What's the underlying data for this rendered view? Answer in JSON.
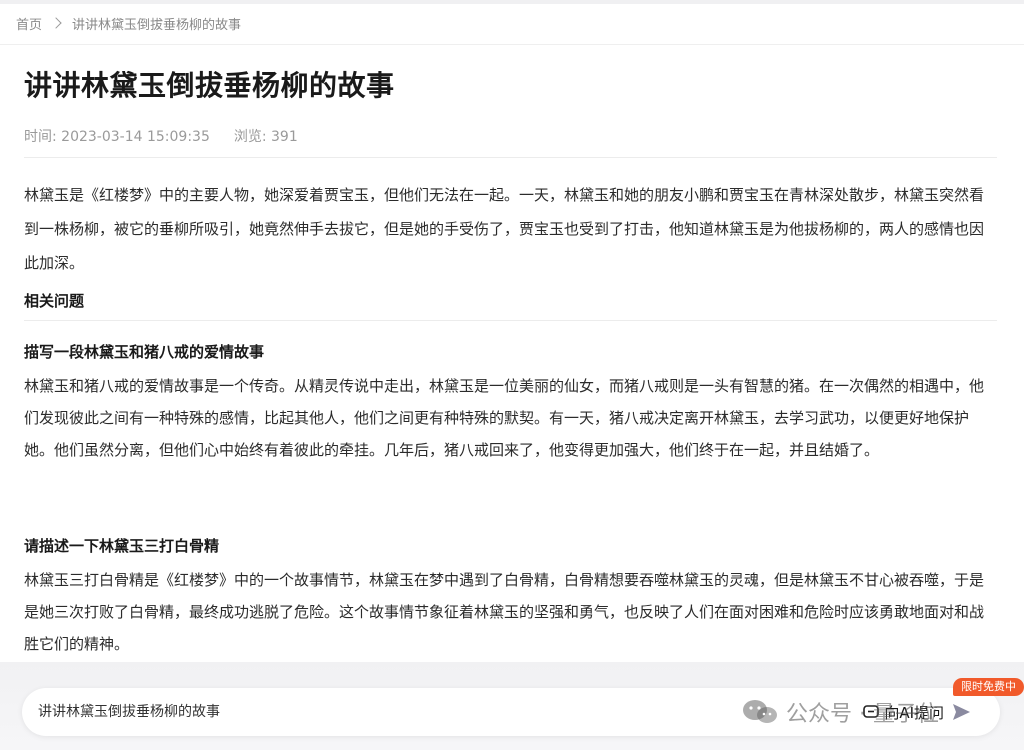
{
  "breadcrumb": {
    "home": "首页",
    "current": "讲讲林黛玉倒拔垂杨柳的故事"
  },
  "article": {
    "title": "讲讲林黛玉倒拔垂杨柳的故事",
    "time": "时间: 2023-03-14 15:09:35",
    "views": "浏览: 391",
    "answer": "林黛玉是《红楼梦》中的主要人物，她深爱着贾宝玉，但他们无法在一起。一天，林黛玉和她的朋友小鹏和贾宝玉在青林深处散步，林黛玉突然看到一株杨柳，被它的垂柳所吸引，她竟然伸手去拔它，但是她的手受伤了，贾宝玉也受到了打击，他知道林黛玉是为他拔杨柳的，两人的感情也因此加深。"
  },
  "related": {
    "heading": "相关问题",
    "items": [
      {
        "question": "描写一段林黛玉和猪八戒的爱情故事",
        "answer": "林黛玉和猪八戒的爱情故事是一个传奇。从精灵传说中走出，林黛玉是一位美丽的仙女，而猪八戒则是一头有智慧的猪。在一次偶然的相遇中，他们发现彼此之间有一种特殊的感情，比起其他人，他们之间更有种特殊的默契。有一天，猪八戒决定离开林黛玉，去学习武功，以便更好地保护她。他们虽然分离，但他们心中始终有着彼此的牵挂。几年后，猪八戒回来了，他变得更加强大，他们终于在一起，并且结婚了。"
      },
      {
        "question": "请描述一下林黛玉三打白骨精",
        "answer": "林黛玉三打白骨精是《红楼梦》中的一个故事情节，林黛玉在梦中遇到了白骨精，白骨精想要吞噬林黛玉的灵魂，但是林黛玉不甘心被吞噬，于是是她三次打败了白骨精，最终成功逃脱了危险。这个故事情节象征着林黛玉的坚强和勇气，也反映了人们在面对困难和危险时应该勇敢地面对和战胜它们的精神。"
      }
    ]
  },
  "ask_bar": {
    "text": "讲讲林黛玉倒拔垂杨柳的故事",
    "button_label": "向AI提问",
    "badge": "限时免费中"
  },
  "watermark": {
    "text": "公众号 · 量子位"
  },
  "colors": {
    "badge": "#f15a2b",
    "text": "#2b2b2b",
    "muted": "#9a9a9a"
  }
}
